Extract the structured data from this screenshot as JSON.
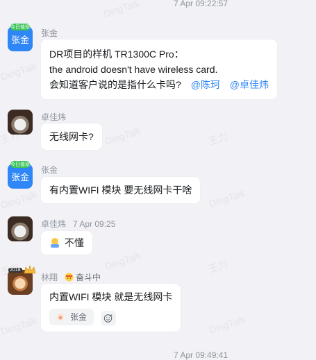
{
  "watermark_words": [
    "DingTalk",
    "王力"
  ],
  "timestamps": {
    "top": "7 Apr 09:22:57",
    "bottom": "7 Apr 09:49:41"
  },
  "messages": [
    {
      "sender": "张金",
      "avatar_text": "张金",
      "avatar_badge": "今日值班",
      "lines": [
        "DR项目的样机 TR1300C Pro：",
        "the android doesn't have wireless card.",
        "会知道客户说的是指什么卡吗?"
      ],
      "mentions": [
        "@陈珂",
        "@卓佳炜"
      ]
    },
    {
      "sender": "卓佳炜",
      "text": "无线网卡?"
    },
    {
      "sender": "张金",
      "avatar_text": "张金",
      "avatar_badge": "今日值班",
      "text": "有内置WIFI 模块 要无线网卡干啥"
    },
    {
      "sender": "卓佳炜",
      "time": "7 Apr 09:25",
      "text": "不懂"
    },
    {
      "sender": "林翔",
      "status": "奋斗中",
      "avatar_badge": "2018",
      "text": "内置WIFI 模块 就是无线网卡",
      "reaction_user": "张金"
    }
  ],
  "colors": {
    "accent": "#2f86f6",
    "background": "#f2f2f6",
    "bubble": "#ffffff"
  }
}
